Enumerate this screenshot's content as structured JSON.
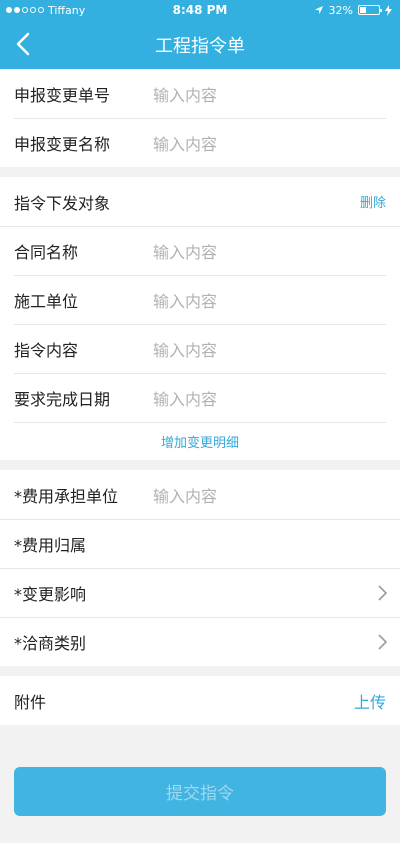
{
  "status_bar": {
    "carrier": "Tiffany",
    "time": "8:48 PM",
    "battery": "32%"
  },
  "header": {
    "title": "工程指令单"
  },
  "change_section": {
    "rows": [
      {
        "label": "申报变更单号",
        "placeholder": "输入内容"
      },
      {
        "label": "申报变更名称",
        "placeholder": "输入内容"
      }
    ]
  },
  "instruction_section": {
    "target_label": "指令下发对象",
    "delete_label": "删除",
    "rows": [
      {
        "label": "合同名称",
        "placeholder": "输入内容"
      },
      {
        "label": "施工单位",
        "placeholder": "输入内容"
      },
      {
        "label": "指令内容",
        "placeholder": "输入内容"
      },
      {
        "label": "要求完成日期",
        "placeholder": "输入内容"
      }
    ],
    "add_detail_label": "增加变更明细"
  },
  "cost_section": {
    "cost_bearer": {
      "label": "*费用承担单位",
      "placeholder": "输入内容"
    },
    "cost_attribution": {
      "label": "*费用归属"
    },
    "change_impact": {
      "label": "*变更影响"
    },
    "negotiation_type": {
      "label": "*洽商类别"
    }
  },
  "attachment_section": {
    "label": "附件",
    "upload_label": "上传"
  },
  "submit_label": "提交指令"
}
